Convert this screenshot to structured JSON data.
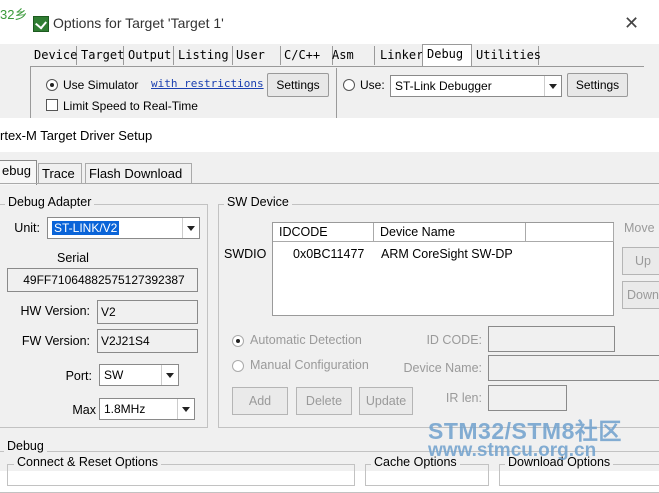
{
  "background_window": {
    "title_fragment": "32乡",
    "title": "Options for Target 'Target 1'",
    "close_glyph": "✕",
    "tabs": [
      "Device",
      "Target",
      "Output",
      "Listing",
      "User",
      "C/C++",
      "Asm",
      "Linker",
      "Debug",
      "Utilities"
    ],
    "selected_tab": "Debug",
    "use_simulator_label": "Use Simulator",
    "with_restrictions_link": "with restrictions",
    "settings_label": "Settings",
    "limit_speed_label": "Limit Speed to Real-Time",
    "use_label": "Use:",
    "debugger_value": "ST-Link Debugger",
    "settings_right_label": "Settings"
  },
  "dialog": {
    "title": "rtex-M Target Driver Setup",
    "tabs": [
      "ebug",
      "Trace",
      "Flash Download"
    ],
    "debug_adapter": {
      "legend": "Debug Adapter",
      "unit_label": "Unit:",
      "unit_value": "ST-LINK/V2",
      "serial_label": "Serial",
      "serial_value": "49FF71064882575127392387",
      "hw_version_label": "HW Version:",
      "hw_version_value": "V2",
      "fw_version_label": "FW Version:",
      "fw_version_value": "V2J21S4",
      "port_label": "Port:",
      "port_value": "SW",
      "max_label": "Max",
      "max_value": "1.8MHz"
    },
    "sw_device": {
      "legend": "SW Device",
      "columns": [
        "IDCODE",
        "Device Name"
      ],
      "row_label": "SWDIO",
      "rows": [
        {
          "idcode": "0x0BC11477",
          "device_name": "ARM CoreSight SW-DP"
        }
      ],
      "move_label": "Move",
      "up_label": "Up",
      "down_label": "Down",
      "automatic_detection_label": "Automatic Detection",
      "manual_configuration_label": "Manual Configuration",
      "id_code_label": "ID CODE:",
      "device_name_label": "Device Name:",
      "ir_len_label": "IR len:",
      "add_label": "Add",
      "delete_label": "Delete",
      "update_label": "Update"
    },
    "debug_section": {
      "legend": "Debug",
      "connect_reset_label": "Connect & Reset Options",
      "cache_options_label": "Cache Options",
      "download_options_label": "Download Options"
    }
  },
  "watermark": {
    "line1": "STM32/STM8社区",
    "line2": "www.stmcu.org.cn"
  }
}
